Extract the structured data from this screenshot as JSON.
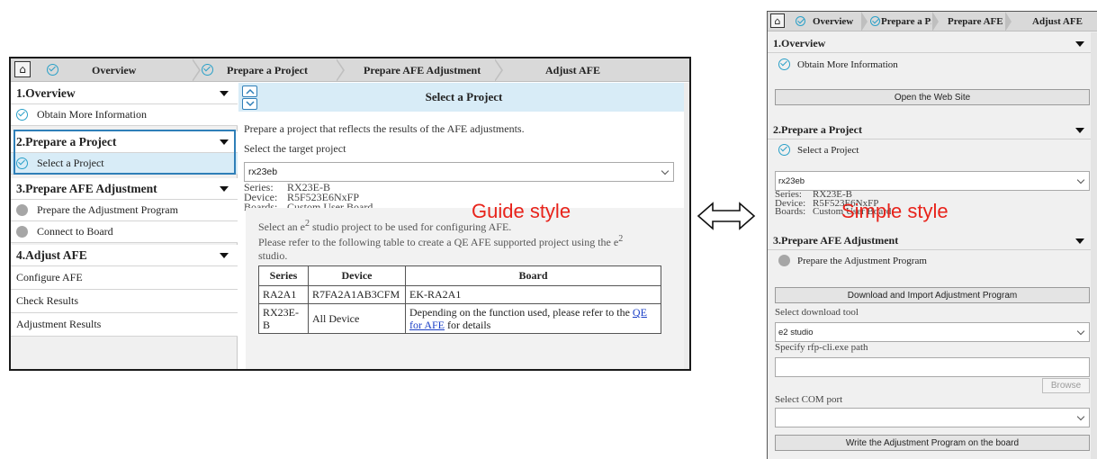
{
  "guide": {
    "breadcrumb": [
      "Overview",
      "Prepare a Project",
      "Prepare AFE Adjustment",
      "Adjust AFE"
    ],
    "sidebar": {
      "sections": [
        {
          "title": "1.Overview",
          "items": [
            {
              "label": "Obtain More Information",
              "status": "done"
            }
          ]
        },
        {
          "title": "2.Prepare a Project",
          "items": [
            {
              "label": "Select a Project",
              "status": "done"
            }
          ]
        },
        {
          "title": "3.Prepare AFE Adjustment",
          "items": [
            {
              "label": "Prepare the Adjustment Program",
              "status": "pending"
            },
            {
              "label": "Connect to Board",
              "status": "pending"
            }
          ]
        },
        {
          "title": "4.Adjust AFE",
          "items": [
            {
              "label": "Configure AFE"
            },
            {
              "label": "Check Results"
            },
            {
              "label": "Adjustment Results"
            }
          ]
        }
      ]
    },
    "main": {
      "heading": "Select a Project",
      "description": "Prepare a project that reflects the results of the AFE adjustments.",
      "select_label": "Select the target project",
      "project_value": "rx23eb",
      "series_key": "Series:",
      "series_val": "RX23E-B",
      "device_key": "Device:",
      "device_val": "R5F523E6NxFP",
      "boards_key": "Boards:",
      "boards_val": "Custom User Board",
      "note_line1_a": "Select an e",
      "note_line1_sup": "2",
      "note_line1_b": " studio project to be used for configuring AFE.",
      "note_line2_a": "Please refer to the following table to create a QE AFE supported project using the e",
      "note_line2_sup": "2",
      "note_line2_b": "studio.",
      "table": {
        "headers": [
          "Series",
          "Device",
          "Board"
        ],
        "rows": [
          [
            "RA2A1",
            "R7FA2A1AB3CFM",
            "EK-RA2A1"
          ],
          [
            "RX23E-B",
            "All Device",
            "Depending on the function used, please refer to the "
          ]
        ],
        "link_text": "QE for AFE",
        "link_tail": " for details"
      }
    },
    "style_label": "Guide style"
  },
  "simple": {
    "breadcrumb": [
      "Overview",
      "Prepare a Pro",
      "Prepare AFE",
      "Adjust AFE"
    ],
    "sections": {
      "overview": {
        "title": "1.Overview",
        "item": "Obtain More Information",
        "button": "Open the Web Site"
      },
      "project": {
        "title": "2.Prepare a Project",
        "item": "Select a Project",
        "value": "rx23eb"
      },
      "afe": {
        "title": "3.Prepare AFE Adjustment",
        "item": "Prepare the Adjustment Program",
        "button": "Download and Import Adjustment Program",
        "tool_label": "Select download tool",
        "tool_value": "e2 studio",
        "path_label": "Specify rfp-cli.exe path",
        "path_value": "",
        "browse": "Browse",
        "com_label": "Select COM port",
        "com_value": "",
        "write_button": "Write the Adjustment Program on the board"
      }
    },
    "series_key": "Series:",
    "series_val": "RX23E-B",
    "device_key": "Device:",
    "device_val": "R5F523E6NxFP",
    "boards_key": "Boards:",
    "boards_val": "Custom User Board",
    "style_label": "Simple style"
  },
  "colors": {
    "accent": "#2f7fb8",
    "banner": "#d8ecf7",
    "label_red": "#e8231b",
    "check": "#2aa0c8"
  }
}
